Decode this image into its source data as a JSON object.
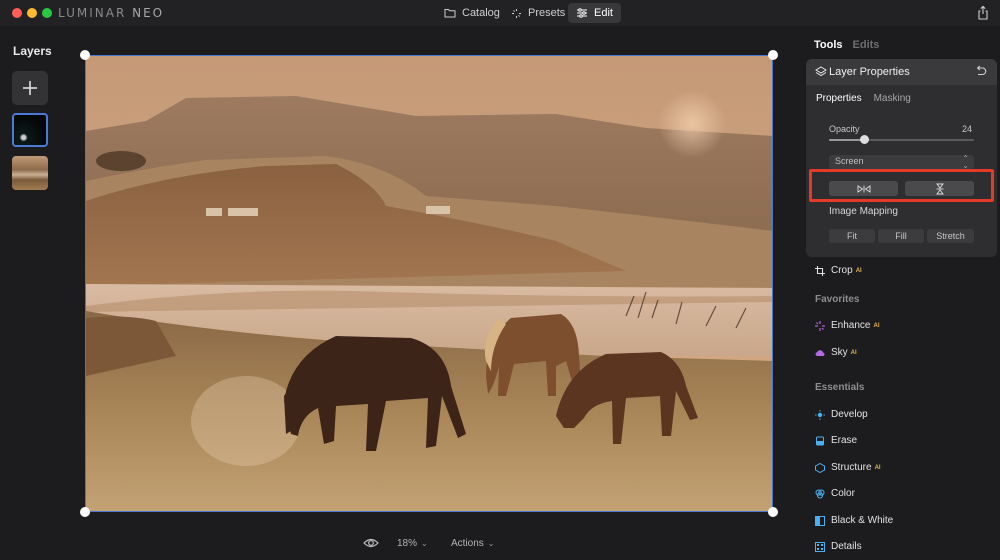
{
  "app": {
    "brand_main": "LUMINAR",
    "brand_sub": "NEO"
  },
  "nav": {
    "items": [
      {
        "label": "Catalog",
        "icon": "folder-icon",
        "active": false
      },
      {
        "label": "Presets",
        "icon": "sparkle-icon",
        "active": false
      },
      {
        "label": "Edit",
        "icon": "sliders-icon",
        "active": true
      }
    ]
  },
  "layers": {
    "title": "Layers"
  },
  "bottom": {
    "zoom": "18%",
    "actions": "Actions"
  },
  "right_panel": {
    "tabs": {
      "tools": "Tools",
      "edits": "Edits"
    },
    "layer_properties": {
      "title": "Layer Properties",
      "subtabs": {
        "properties": "Properties",
        "masking": "Masking"
      },
      "opacity_label": "Opacity",
      "opacity_value": "24",
      "opacity_fraction": 0.24,
      "blend_mode": "Screen",
      "image_mapping_label": "Image Mapping",
      "mapping_options": {
        "fit": "Fit",
        "fill": "Fill",
        "stretch": "Stretch"
      }
    },
    "crop": {
      "label": "Crop",
      "ai": "AI"
    },
    "favorites": {
      "title": "Favorites",
      "items": [
        {
          "label": "Enhance",
          "ai": "AI"
        },
        {
          "label": "Sky",
          "ai": "AI"
        }
      ]
    },
    "essentials": {
      "title": "Essentials",
      "items": [
        {
          "label": "Develop",
          "ai": ""
        },
        {
          "label": "Erase",
          "ai": ""
        },
        {
          "label": "Structure",
          "ai": "AI"
        },
        {
          "label": "Color",
          "ai": ""
        },
        {
          "label": "Black & White",
          "ai": ""
        },
        {
          "label": "Details",
          "ai": ""
        }
      ]
    }
  },
  "colors": {
    "accent_blue": "#4b77d1",
    "highlight_red": "#e53a2a",
    "ai_badge": "#e6b34a"
  }
}
